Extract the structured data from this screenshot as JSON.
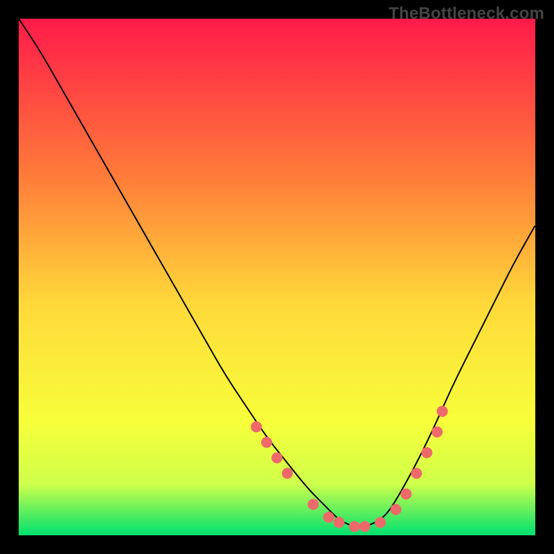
{
  "watermark": "TheBottleneck.com",
  "chart_data": {
    "type": "line",
    "title": "",
    "xlabel": "",
    "ylabel": "",
    "xlim": [
      0,
      100
    ],
    "ylim": [
      0,
      100
    ],
    "grid": false,
    "legend": false,
    "background_gradient": {
      "top": "#ff1a4a",
      "mid_upper": "#ff7a3a",
      "mid": "#ffd83a",
      "mid_lower": "#f7ff3a",
      "band": "#cfff4a",
      "bottom": "#00e070"
    },
    "curve": {
      "name": "bottleneck-curve",
      "x": [
        0,
        4,
        8,
        12,
        16,
        20,
        24,
        28,
        32,
        36,
        40,
        44,
        48,
        52,
        56,
        60,
        62,
        64,
        66,
        68,
        70,
        72,
        76,
        80,
        84,
        88,
        92,
        96,
        100
      ],
      "y": [
        100,
        94,
        87,
        80,
        73,
        66,
        59,
        52,
        45,
        38,
        31,
        25,
        19,
        14,
        9,
        5,
        3,
        2,
        1.5,
        2,
        3,
        5,
        12,
        20,
        29,
        37,
        45,
        53,
        60
      ]
    },
    "markers": {
      "name": "highlight-dots",
      "color": "#ee6a6a",
      "x": [
        46,
        48,
        50,
        52,
        57,
        60,
        62,
        65,
        67,
        70,
        73,
        75,
        77,
        79,
        81,
        82
      ],
      "y": [
        21,
        18,
        15,
        12,
        6,
        3.5,
        2.5,
        1.7,
        1.7,
        2.5,
        5,
        8,
        12,
        16,
        20,
        24
      ]
    }
  }
}
